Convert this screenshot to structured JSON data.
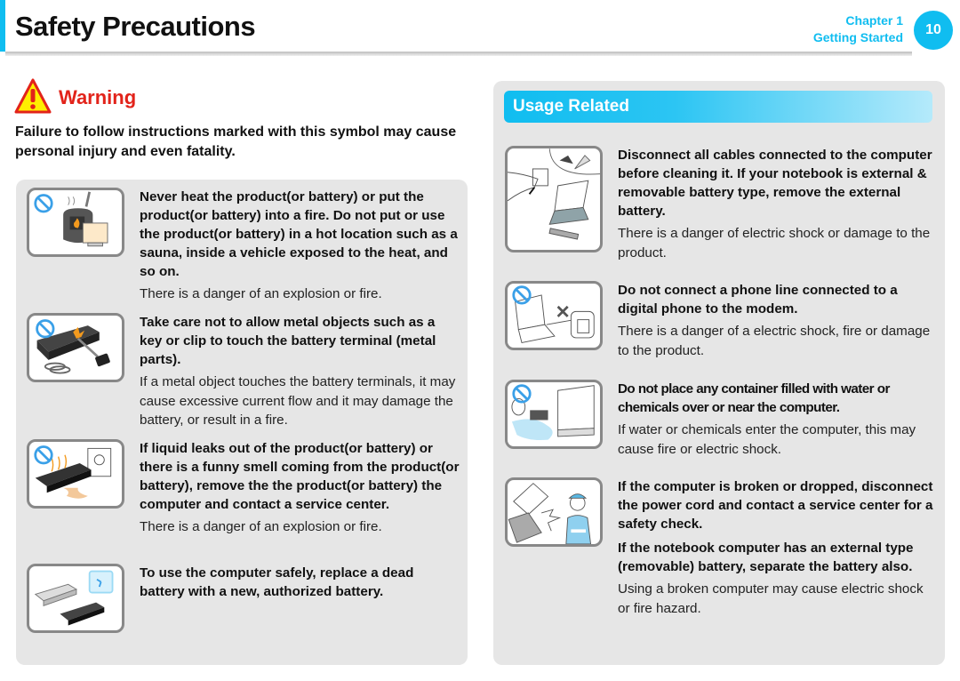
{
  "header": {
    "title": "Safety Precautions",
    "chapter": "Chapter 1",
    "chapter_name": "Getting Started",
    "page_number": "10",
    "accent_color": "#10bdf0"
  },
  "warning": {
    "icon": "warning-triangle-icon",
    "title": "Warning",
    "title_color": "#e2231a",
    "description": "Failure to follow instructions marked with this symbol may cause personal injury and even fatality."
  },
  "left_items": [
    {
      "icon": "prohibited-heat-fire-icon",
      "instruction": "Never heat the product(or battery) or put the product(or battery) into a fire. Do not put or use the product(or battery) in a hot location such as a sauna, inside a vehicle exposed to the heat, and so on.",
      "consequence": "There is a danger of an explosion or fire."
    },
    {
      "icon": "prohibited-metal-contact-icon",
      "instruction": "Take care not to allow metal objects such as a key or clip to touch the battery terminal (metal parts).",
      "consequence": "If a metal object touches the battery terminals, it may cause excessive current flow and it may damage the battery, or result in a fire."
    },
    {
      "icon": "prohibited-battery-leak-icon",
      "instruction": "If liquid leaks out of the product(or battery) or there is a funny smell coming from the product(or battery), remove the the product(or battery) the computer and contact a service center.",
      "consequence": "There is a danger of an explosion or fire."
    },
    {
      "icon": "battery-replace-icon",
      "instruction": "To use the computer safely, replace a dead battery with a new, authorized battery.",
      "consequence": ""
    }
  ],
  "usage_related": {
    "title": "Usage Related",
    "items": [
      {
        "icon": "unplug-cables-icon",
        "instruction": "Disconnect all cables connected to the computer before cleaning it. If your notebook is external & removable battery type, remove the external battery.",
        "consequence": "There is a danger of electric shock or damage to the product."
      },
      {
        "icon": "prohibited-phone-line-icon",
        "instruction": "Do not connect a phone line connected to a digital phone to the modem.",
        "consequence": "There is a danger of a electric shock, fire or damage to the product."
      },
      {
        "icon": "prohibited-water-container-icon",
        "instruction": "Do not place any container filled with water or chemicals over or near the computer.",
        "consequence": "If water or chemicals enter the computer, this may cause fire or electric shock."
      },
      {
        "icon": "broken-computer-service-icon",
        "instruction": "If the computer is broken or dropped, disconnect the power cord and contact a service center for a safety check.",
        "instruction_2": "If the notebook computer has an external type (removable) battery, separate the battery also.",
        "consequence": "Using a broken computer may cause electric shock or fire hazard."
      }
    ]
  }
}
